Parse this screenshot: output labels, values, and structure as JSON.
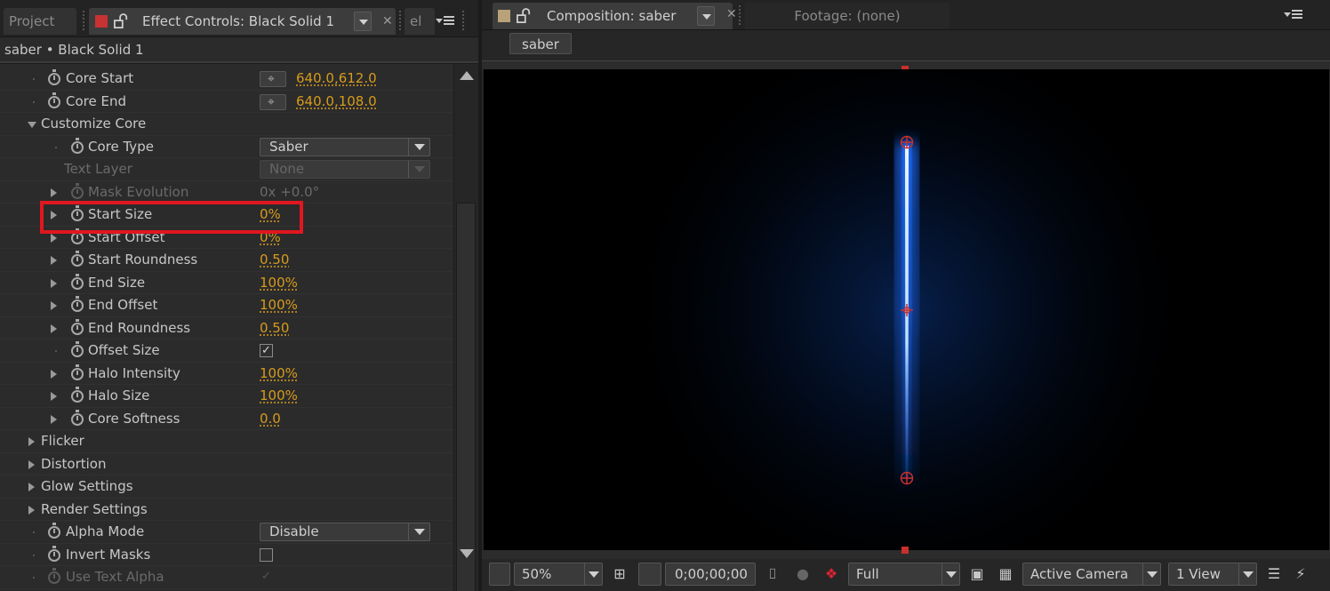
{
  "left_panel": {
    "tabs": {
      "project": "Project",
      "effect_controls": "Effect Controls: Black Solid 1",
      "truncated": "el"
    },
    "swatch_color": "#c83232",
    "layer_title": "saber • Black Solid 1",
    "rows": [
      {
        "label": "Core Start",
        "value": "640.0,612.0",
        "control": "point"
      },
      {
        "label": "Core End",
        "value": "640.0,108.0",
        "control": "point"
      },
      {
        "label": "Customize Core",
        "group": true
      },
      {
        "label": "Core Type",
        "value": "Saber",
        "control": "select"
      },
      {
        "label": "Text Layer",
        "value": "None",
        "control": "select",
        "disabled": true
      },
      {
        "label": "Mask Evolution",
        "value": "0x +0.0°",
        "disabled": true
      },
      {
        "label": "Start Size",
        "value": "0%",
        "highlighted": true
      },
      {
        "label": "Start Offset",
        "value": "0%"
      },
      {
        "label": "Start Roundness",
        "value": "0.50"
      },
      {
        "label": "End Size",
        "value": "100%"
      },
      {
        "label": "End Offset",
        "value": "100%"
      },
      {
        "label": "End Roundness",
        "value": "0.50"
      },
      {
        "label": "Offset Size",
        "checked": true
      },
      {
        "label": "Halo Intensity",
        "value": "100%"
      },
      {
        "label": "Halo Size",
        "value": "100%"
      },
      {
        "label": "Core Softness",
        "value": "0.0"
      },
      {
        "label": "Flicker",
        "group": true
      },
      {
        "label": "Distortion",
        "group": true
      },
      {
        "label": "Glow Settings",
        "group": true
      },
      {
        "label": "Render Settings",
        "group": true
      },
      {
        "label": "Alpha Mode",
        "value": "Disable",
        "control": "select"
      },
      {
        "label": "Invert Masks",
        "checked": false
      },
      {
        "label": "Use Text Alpha",
        "checked": true,
        "disabled": true
      }
    ]
  },
  "right_panel": {
    "tabs": {
      "composition": "Composition: saber",
      "footage": "Footage: (none)"
    },
    "swatch_color": "#b8a27a",
    "comp_chip": "saber",
    "toolbar": {
      "magnification": "50%",
      "timecode": "0;00;00;00",
      "resolution": "Full",
      "camera": "Active Camera",
      "views": "1 View"
    }
  },
  "colors": {
    "value_orange": "#d79b1c",
    "highlight_red": "#e0171f",
    "saber_core": "#e8f6ff",
    "saber_glow": "#1e6cff"
  }
}
